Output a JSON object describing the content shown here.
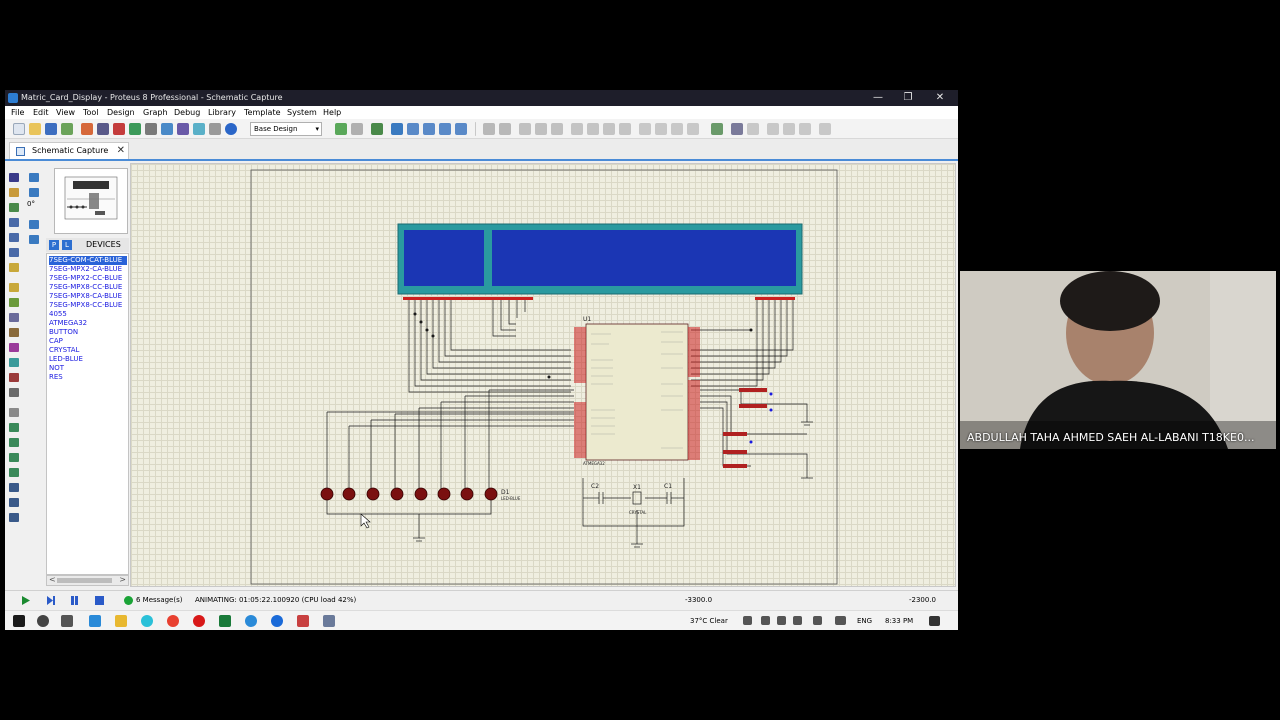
{
  "window": {
    "title": "Matric_Card_Display - Proteus 8 Professional - Schematic Capture",
    "controls": {
      "minimize": "—",
      "restore": "❐",
      "close": "✕"
    }
  },
  "menu": [
    "File",
    "Edit",
    "View",
    "Tool",
    "Design",
    "Graph",
    "Debug",
    "Library",
    "Template",
    "System",
    "Help"
  ],
  "toolbar": {
    "design_select": "Base Design"
  },
  "tab": {
    "label": "Schematic Capture",
    "close": "✕"
  },
  "device_panel": {
    "p_button": "P",
    "l_button": "L",
    "header": "DEVICES",
    "items": [
      "7SEG-COM-CAT-BLUE",
      "7SEG-MPX2-CA-BLUE",
      "7SEG-MPX2-CC-BLUE",
      "7SEG-MPX8-CC-BLUE",
      "7SEG-MPX8-CA-BLUE",
      "7SEG-MPX8-CC-BLUE",
      "4055",
      "ATMEGA32",
      "BUTTON",
      "CAP",
      "CRYSTAL",
      "LED-BLUE",
      "NOT",
      "RES"
    ],
    "selected_index": 0,
    "scroll_left": "<",
    "scroll_right": ">"
  },
  "schematic": {
    "mcu_label": "U1",
    "mcu_part": "ATMEGA32",
    "led_label": "D1",
    "led_part": "LED-BLUE",
    "crystal_label": "X1",
    "crystal_part": "CRYSTAL",
    "cap1": "C1",
    "cap2": "C2"
  },
  "status": {
    "messages": "6 Message(s)",
    "animation": "ANIMATING: 01:05:22.100920 (CPU load 42%)",
    "coord_x": "-3300.0",
    "coord_y": "-2300.0"
  },
  "taskbar": {
    "weather": "37°C  Clear",
    "language": "ENG",
    "time": "8:33 PM"
  },
  "webcam": {
    "name": "ABDULLAH TAHA AHMED SAEH AL-LABANI T18KE0..."
  },
  "colors": {
    "title_bar": "#1e1e2a",
    "lcd_blue": "#1b36b4",
    "lcd_frame": "#2a9aa0",
    "led_red": "#8b1010",
    "wire": "#1a1a1a",
    "pin": "#cc2020",
    "selection": "#2a63d8"
  }
}
